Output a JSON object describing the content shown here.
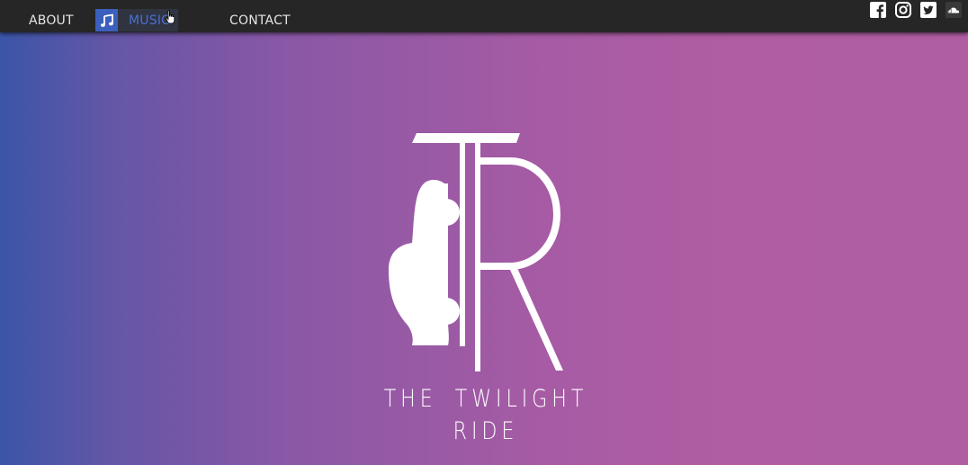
{
  "nav": {
    "about": "ABOUT",
    "music": "MUSIC",
    "contact": "CONTACT"
  },
  "social": {
    "icons": [
      "facebook-icon",
      "instagram-icon",
      "twitter-icon",
      "soundcloud-icon"
    ]
  },
  "hero": {
    "logo_letters": "TR",
    "tagline": "THE TWILIGHT RIDE"
  },
  "colors": {
    "navbar_bg": "#262626",
    "nav_text": "#e6e6e6",
    "music_active": "#3b5fbd",
    "gradient_left": "#3b55a8",
    "gradient_right": "#b05ea3"
  }
}
